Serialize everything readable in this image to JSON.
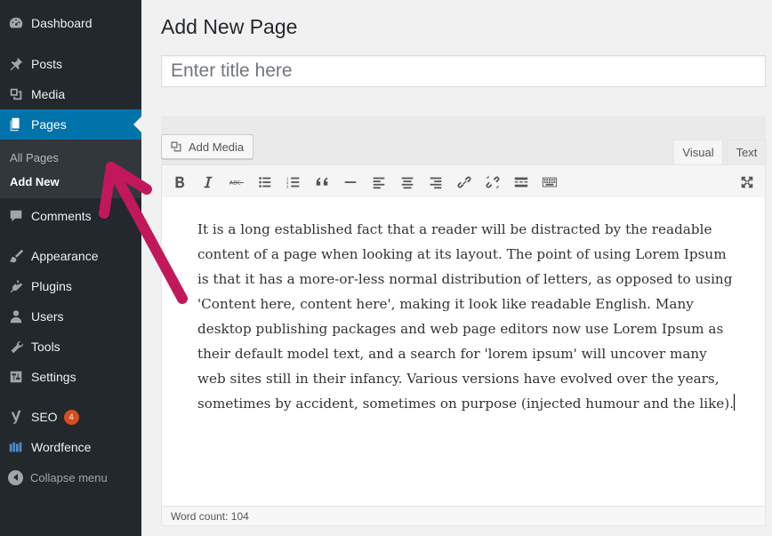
{
  "sidebar": {
    "items": [
      {
        "label": "Dashboard",
        "icon": "dashboard-icon"
      },
      {
        "label": "Posts",
        "icon": "pin-icon"
      },
      {
        "label": "Media",
        "icon": "media-icon"
      },
      {
        "label": "Pages",
        "icon": "pages-icon"
      },
      {
        "label": "Comments",
        "icon": "comments-icon"
      },
      {
        "label": "Appearance",
        "icon": "paintbrush-icon"
      },
      {
        "label": "Plugins",
        "icon": "plugins-icon"
      },
      {
        "label": "Users",
        "icon": "users-icon"
      },
      {
        "label": "Tools",
        "icon": "wrench-icon"
      },
      {
        "label": "Settings",
        "icon": "settings-icon"
      },
      {
        "label": "SEO",
        "icon": "yoast-icon",
        "badge": "4"
      },
      {
        "label": "Wordfence",
        "icon": "wordfence-icon"
      }
    ],
    "submenu": [
      {
        "label": "All Pages"
      },
      {
        "label": "Add New",
        "current": true
      }
    ],
    "collapse_label": "Collapse menu"
  },
  "main": {
    "title": "Add New Page",
    "title_placeholder": "Enter title here",
    "add_media_label": "Add Media",
    "tabs": [
      {
        "label": "Visual",
        "active": true
      },
      {
        "label": "Text"
      }
    ],
    "toolbar": [
      "bold-icon",
      "italic-icon",
      "strikethrough-icon",
      "bullet-list-icon",
      "numbered-list-icon",
      "blockquote-icon",
      "horizontal-line-icon",
      "align-left-icon",
      "align-center-icon",
      "align-right-icon",
      "link-icon",
      "unlink-icon",
      "read-more-icon",
      "toolbar-toggle-icon",
      "fullscreen-icon"
    ],
    "content": "It is a long established fact that a reader will be distracted by the readable content of a page when looking at its layout. The point of using Lorem Ipsum is that it has a more-or-less normal distribution of letters, as opposed to using 'Content here, content here', making it look like readable English. Many desktop publishing packages and web page editors now use Lorem Ipsum as their default model text, and a search for 'lorem ipsum' will uncover many web sites still in their infancy. Various versions have evolved over the years, sometimes by accident, sometimes on purpose (injected humour and the like).",
    "word_count": "Word count: 104"
  },
  "colors": {
    "sidebar": "#23282d",
    "active": "#0073aa",
    "arrow": "#c2185b",
    "badge": "#d54e21"
  }
}
